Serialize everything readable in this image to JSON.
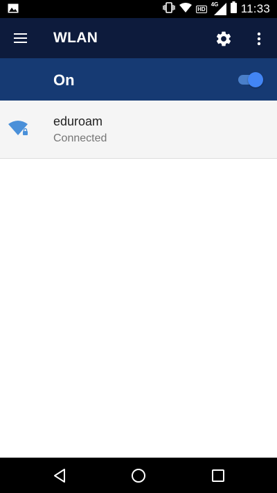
{
  "status_bar": {
    "time": "11:33",
    "hd_label": "HD",
    "network_label": "4G"
  },
  "app_bar": {
    "title": "WLAN"
  },
  "master_switch": {
    "label": "On",
    "enabled": true
  },
  "networks": [
    {
      "ssid": "eduroam",
      "status": "Connected",
      "secured": true
    }
  ],
  "colors": {
    "app_bar": "#0d1b3c",
    "switch_bar": "#163a73",
    "accent": "#4285f4"
  }
}
